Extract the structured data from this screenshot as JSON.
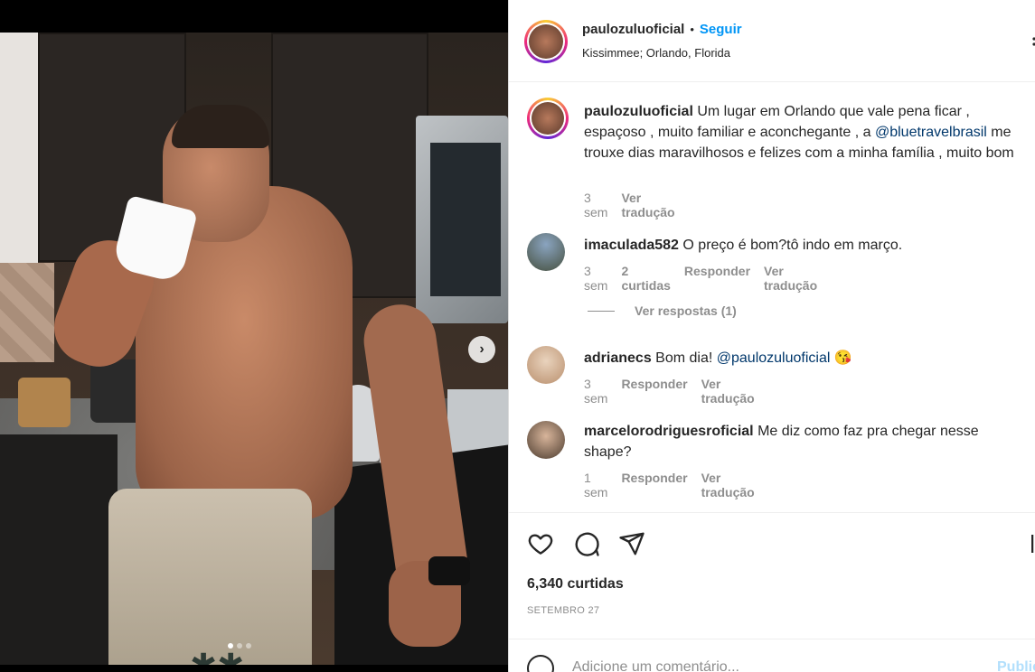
{
  "post": {
    "username": "paulozuluoficial",
    "separator": "•",
    "follow_label": "Seguir",
    "location": "Kissimmee; Orlando, Florida",
    "more_icon": "bookmark-icon"
  },
  "caption": {
    "username": "paulozuluoficial",
    "text_before": " Um lugar em Orlando que vale pena ficar , espaçoso , muito familiar e aconchegante , a ",
    "mention": "@bluetravelbrasil",
    "text_after": " me trouxe dias maravilhosos e felizes com a minha família , muito bom",
    "time": "3 sem",
    "translate": "Ver tradução"
  },
  "comments": [
    {
      "username": "imaculada582",
      "text": " O preço é bom?tô indo em março.",
      "time": "3 sem",
      "likes": "2 curtidas",
      "reply": "Responder",
      "translate": "Ver tradução",
      "view_replies": "Ver respostas (1)"
    },
    {
      "username": "adrianecs",
      "text_before": " Bom dia! ",
      "mention": "@paulozuluoficial",
      "emoji": "😘",
      "time": "3 sem",
      "reply": "Responder",
      "translate": "Ver tradução"
    },
    {
      "username": "marcelorodriguesroficial",
      "text": " Me diz como faz pra chegar nesse shape?",
      "time": "1 sem",
      "reply": "Responder",
      "translate": "Ver tradução"
    }
  ],
  "actions": {
    "likes": "6,340 curtidas",
    "date": "SETEMBRO 27"
  },
  "add_comment": {
    "placeholder": "Adicione um comentário...",
    "publish": "Publicar"
  },
  "carousel": {
    "next_glyph": "›"
  },
  "colors": {
    "accent": "#0095f6",
    "mention": "#00376b",
    "muted": "#8e8e8e"
  }
}
